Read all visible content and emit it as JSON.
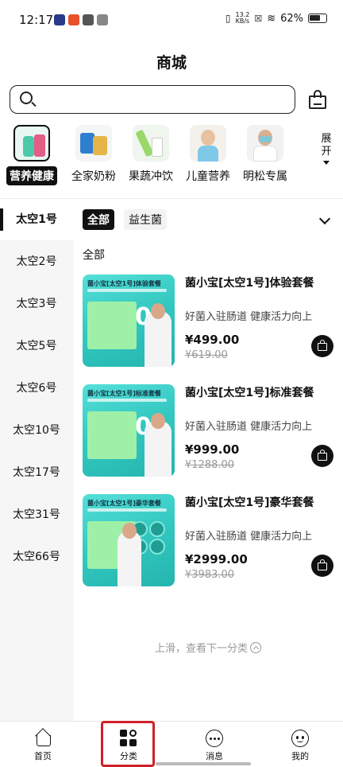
{
  "status": {
    "time": "12:17",
    "net_speed": "13.2",
    "net_unit": "KB/s",
    "battery": "62%"
  },
  "header": {
    "title": "商城"
  },
  "search": {
    "placeholder": ""
  },
  "categories": [
    {
      "label": "营养健康",
      "active": true
    },
    {
      "label": "全家奶粉",
      "active": false
    },
    {
      "label": "果蔬冲饮",
      "active": false
    },
    {
      "label": "儿童营养",
      "active": false
    },
    {
      "label": "明松专属",
      "active": false
    }
  ],
  "expand_label": "展开",
  "sidebar": {
    "items": [
      "太空1号",
      "太空2号",
      "太空3号",
      "太空5号",
      "太空6号",
      "太空10号",
      "太空17号",
      "太空31号",
      "太空66号"
    ],
    "active_index": 0
  },
  "filters": {
    "chips": [
      "全部",
      "益生菌"
    ]
  },
  "section_title": "全部",
  "products": [
    {
      "name": "菌小宝[太空1号]体验套餐",
      "desc": "好菌入驻肠道 健康活力向上",
      "price": "¥499.00",
      "original_price": "¥619.00",
      "image_title": "菌小宝[太空1号]体验套餐"
    },
    {
      "name": "菌小宝[太空1号]标准套餐",
      "desc": "好菌入驻肠道 健康活力向上",
      "price": "¥999.00",
      "original_price": "¥1288.00",
      "image_title": "菌小宝[太空1号]标准套餐"
    },
    {
      "name": "菌小宝[太空1号]豪华套餐",
      "desc": "好菌入驻肠道 健康活力向上",
      "price": "¥2999.00",
      "original_price": "¥3983.00",
      "image_title": "菌小宝[太空1号]豪华套餐"
    }
  ],
  "scroll_hint": "上滑，查看下一分类",
  "nav": {
    "items": [
      {
        "label": "首页",
        "icon": "home-icon"
      },
      {
        "label": "分类",
        "icon": "category-icon"
      },
      {
        "label": "消息",
        "icon": "message-icon"
      },
      {
        "label": "我的",
        "icon": "profile-icon"
      }
    ]
  },
  "colors": {
    "accent": "#111111",
    "product_bg": "#32c7c0",
    "highlight": "#d0202a"
  }
}
